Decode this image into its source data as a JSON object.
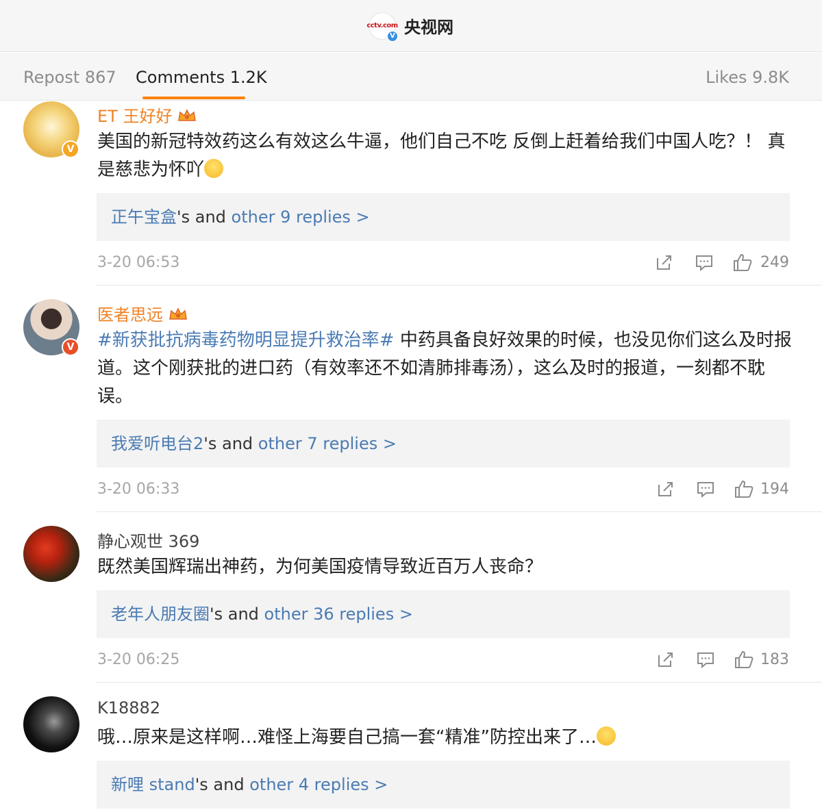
{
  "header": {
    "logo_text": "cctv.com",
    "verified_mark": "V",
    "title": "央视网"
  },
  "tabs": {
    "repost": "Repost 867",
    "comments": "Comments 1.2K",
    "likes": "Likes 9.8K"
  },
  "icons": [
    "share-icon",
    "comment-icon",
    "like-icon",
    "crown-icon",
    "verified-icon"
  ],
  "colors": {
    "accent": "#ff8200",
    "link": "#4a7bb3",
    "vip_name": "#f08224"
  },
  "comments": [
    {
      "user": "ET 王好好",
      "badge": "V",
      "text": "美国的新冠特效药这么有效这么牛逼，他们自己不吃 反倒上赶着给我们中国人吃？！ 真是慈悲为怀吖",
      "reply_user": "正午宝盒",
      "reply_mid": "'s and ",
      "reply_more": "other 9 replies >",
      "time": "3-20 06:53",
      "likes": "249"
    },
    {
      "user": "医者思远",
      "badge": "V",
      "hashtag": "#新获批抗病毒药物明显提升救治率#",
      "text": " 中药具备良好效果的时候，也没见你们这么及时报道。这个刚获批的进口药（有效率还不如清肺排毒汤），这么及时的报道，一刻都不耽误。",
      "reply_user": "我爱听电台2",
      "reply_mid": "'s and ",
      "reply_more": "other 7 replies >",
      "time": "3-20 06:33",
      "likes": "194"
    },
    {
      "user": "静心观世 369",
      "text": "既然美国辉瑞出神药，为何美国疫情导致近百万人丧命？",
      "reply_user": "老年人朋友圈",
      "reply_mid": "'s and ",
      "reply_more": "other 36 replies >",
      "time": "3-20 06:25",
      "likes": "183"
    },
    {
      "user": "K18882",
      "text": "哦…原来是这样啊…难怪上海要自己搞一套“精准”防控出来了…",
      "reply_user": "新哩 stand",
      "reply_mid": "'s and ",
      "reply_more": "other 4 replies >"
    }
  ]
}
